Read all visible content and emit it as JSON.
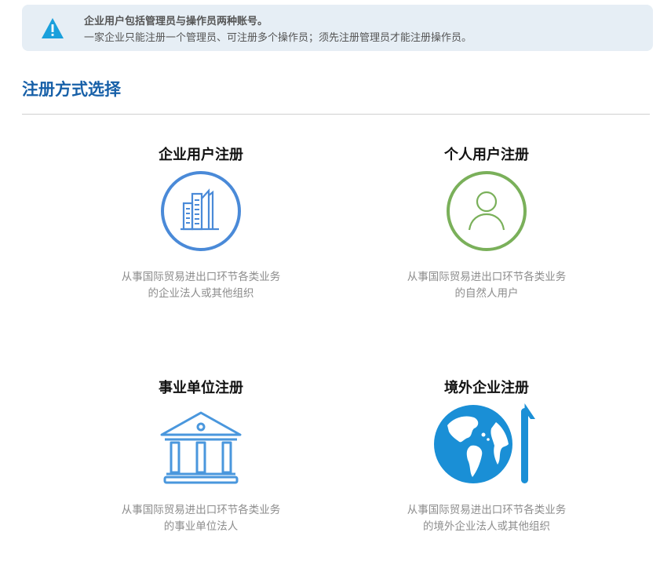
{
  "notice": {
    "title": "企业用户包括管理员与操作员两种账号。",
    "description": "一家企业只能注册一个管理员、可注册多个操作员；须先注册管理员才能注册操作员。",
    "icon": "warning-icon",
    "icon_color": "#1aa0dc"
  },
  "section": {
    "title": "注册方式选择"
  },
  "options": [
    {
      "title": "企业用户注册",
      "icon": "building-icon",
      "accent": "#4a8ad8",
      "desc_line1": "从事国际贸易进出口环节各类业务",
      "desc_line2": "的企业法人或其他组织"
    },
    {
      "title": "个人用户注册",
      "icon": "person-icon",
      "accent": "#7ab05a",
      "desc_line1": "从事国际贸易进出口环节各类业务",
      "desc_line2": "的自然人用户"
    },
    {
      "title": "事业单位注册",
      "icon": "institution-building-icon",
      "accent": "#4a97dd",
      "desc_line1": "从事国际贸易进出口环节各类业务",
      "desc_line2": "的事业单位法人"
    },
    {
      "title": "境外企业注册",
      "icon": "globe-icon",
      "accent": "#1a8fd6",
      "desc_line1": "从事国际贸易进出口环节各类业务",
      "desc_line2": "的境外企业法人或其他组织"
    }
  ]
}
